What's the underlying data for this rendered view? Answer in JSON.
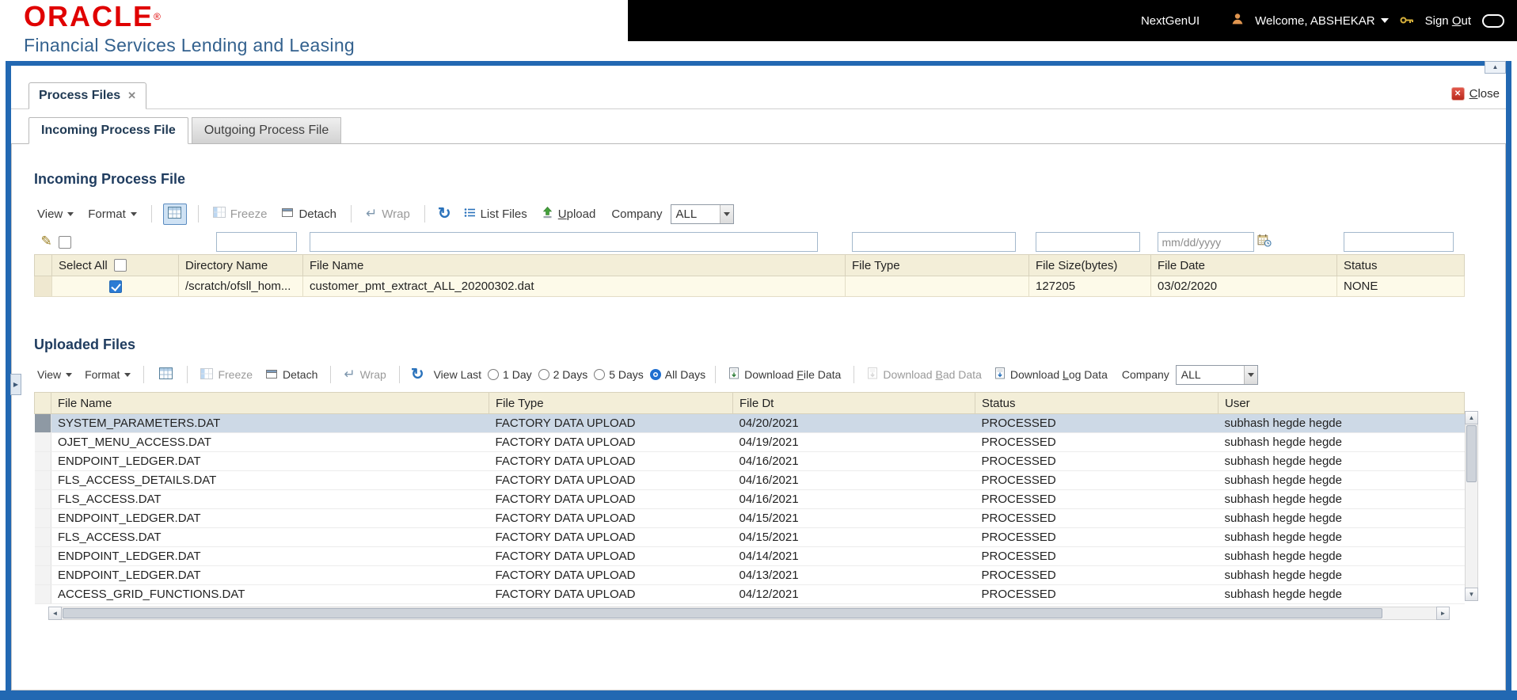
{
  "icons": {
    "dropdown_arrow": "▾",
    "scroll_up": "▲",
    "scroll_down": "▼",
    "scroll_left": "◄",
    "scroll_right": "►",
    "pencil": "✎",
    "refresh": "↻",
    "wrap": "↵",
    "close_x": "✕",
    "tab_close": "✕",
    "expander": "▶"
  },
  "header": {
    "logo_primary": "ORACLE",
    "logo_registered": "®",
    "logo_secondary": "Financial Services Lending and Leasing",
    "nextgen_label": "NextGenUI",
    "welcome_label": "Welcome, ABSHEKAR",
    "sign_out": {
      "prefix": "Sign ",
      "key": "O",
      "suffix": "ut"
    }
  },
  "window": {
    "tab_label": "Process Files",
    "close": {
      "key": "C",
      "suffix": "lose"
    }
  },
  "tabs": {
    "incoming": "Incoming Process File",
    "outgoing": "Outgoing Process File"
  },
  "incoming": {
    "title": "Incoming Process File",
    "toolbar": {
      "view": "View",
      "format": "Format",
      "freeze": "Freeze",
      "detach": "Detach",
      "wrap": "Wrap",
      "list_files": "List Files",
      "upload": {
        "key": "U",
        "suffix": "pload"
      },
      "company_label": "Company",
      "company_value": "ALL"
    },
    "filter": {
      "date_placeholder": "mm/dd/yyyy"
    },
    "table": {
      "select_all_label": "Select All",
      "columns": [
        "Directory Name",
        "File Name",
        "File Type",
        "File Size(bytes)",
        "File Date",
        "Status"
      ],
      "rows": [
        {
          "selected": true,
          "directory": "/scratch/ofsll_hom...",
          "file_name": "customer_pmt_extract_ALL_20200302.dat",
          "file_type": "",
          "file_size": "127205",
          "file_date": "03/02/2020",
          "status": "NONE"
        }
      ]
    }
  },
  "uploaded": {
    "title": "Uploaded Files",
    "toolbar": {
      "view": "View",
      "format": "Format",
      "freeze": "Freeze",
      "detach": "Detach",
      "wrap": "Wrap",
      "view_last_label": "View Last",
      "radios": [
        "1 Day",
        "2 Days",
        "5 Days",
        "All Days"
      ],
      "selected_radio": "All Days",
      "download_file": {
        "prefix": "Download ",
        "key": "F",
        "suffix": "ile Data"
      },
      "download_bad": {
        "prefix": "Download ",
        "key": "B",
        "suffix": "ad Data"
      },
      "download_log": {
        "prefix": "Download ",
        "key": "L",
        "suffix": "og Data"
      },
      "company_label": "Company",
      "company_value": "ALL"
    },
    "table": {
      "columns": [
        "File Name",
        "File Type",
        "File Dt",
        "Status",
        "User"
      ],
      "rows": [
        {
          "selected": true,
          "file_name": "SYSTEM_PARAMETERS.DAT",
          "file_type": "FACTORY DATA UPLOAD",
          "file_dt": "04/20/2021",
          "status": "PROCESSED",
          "user": "subhash hegde hegde"
        },
        {
          "selected": false,
          "file_name": "OJET_MENU_ACCESS.DAT",
          "file_type": "FACTORY DATA UPLOAD",
          "file_dt": "04/19/2021",
          "status": "PROCESSED",
          "user": "subhash hegde hegde"
        },
        {
          "selected": false,
          "file_name": "ENDPOINT_LEDGER.DAT",
          "file_type": "FACTORY DATA UPLOAD",
          "file_dt": "04/16/2021",
          "status": "PROCESSED",
          "user": "subhash hegde hegde"
        },
        {
          "selected": false,
          "file_name": "FLS_ACCESS_DETAILS.DAT",
          "file_type": "FACTORY DATA UPLOAD",
          "file_dt": "04/16/2021",
          "status": "PROCESSED",
          "user": "subhash hegde hegde"
        },
        {
          "selected": false,
          "file_name": "FLS_ACCESS.DAT",
          "file_type": "FACTORY DATA UPLOAD",
          "file_dt": "04/16/2021",
          "status": "PROCESSED",
          "user": "subhash hegde hegde"
        },
        {
          "selected": false,
          "file_name": "ENDPOINT_LEDGER.DAT",
          "file_type": "FACTORY DATA UPLOAD",
          "file_dt": "04/15/2021",
          "status": "PROCESSED",
          "user": "subhash hegde hegde"
        },
        {
          "selected": false,
          "file_name": "FLS_ACCESS.DAT",
          "file_type": "FACTORY DATA UPLOAD",
          "file_dt": "04/15/2021",
          "status": "PROCESSED",
          "user": "subhash hegde hegde"
        },
        {
          "selected": false,
          "file_name": "ENDPOINT_LEDGER.DAT",
          "file_type": "FACTORY DATA UPLOAD",
          "file_dt": "04/14/2021",
          "status": "PROCESSED",
          "user": "subhash hegde hegde"
        },
        {
          "selected": false,
          "file_name": "ENDPOINT_LEDGER.DAT",
          "file_type": "FACTORY DATA UPLOAD",
          "file_dt": "04/13/2021",
          "status": "PROCESSED",
          "user": "subhash hegde hegde"
        },
        {
          "selected": false,
          "file_name": "ACCESS_GRID_FUNCTIONS.DAT",
          "file_type": "FACTORY DATA UPLOAD",
          "file_dt": "04/12/2021",
          "status": "PROCESSED",
          "user": "subhash hegde hegde"
        }
      ]
    }
  }
}
